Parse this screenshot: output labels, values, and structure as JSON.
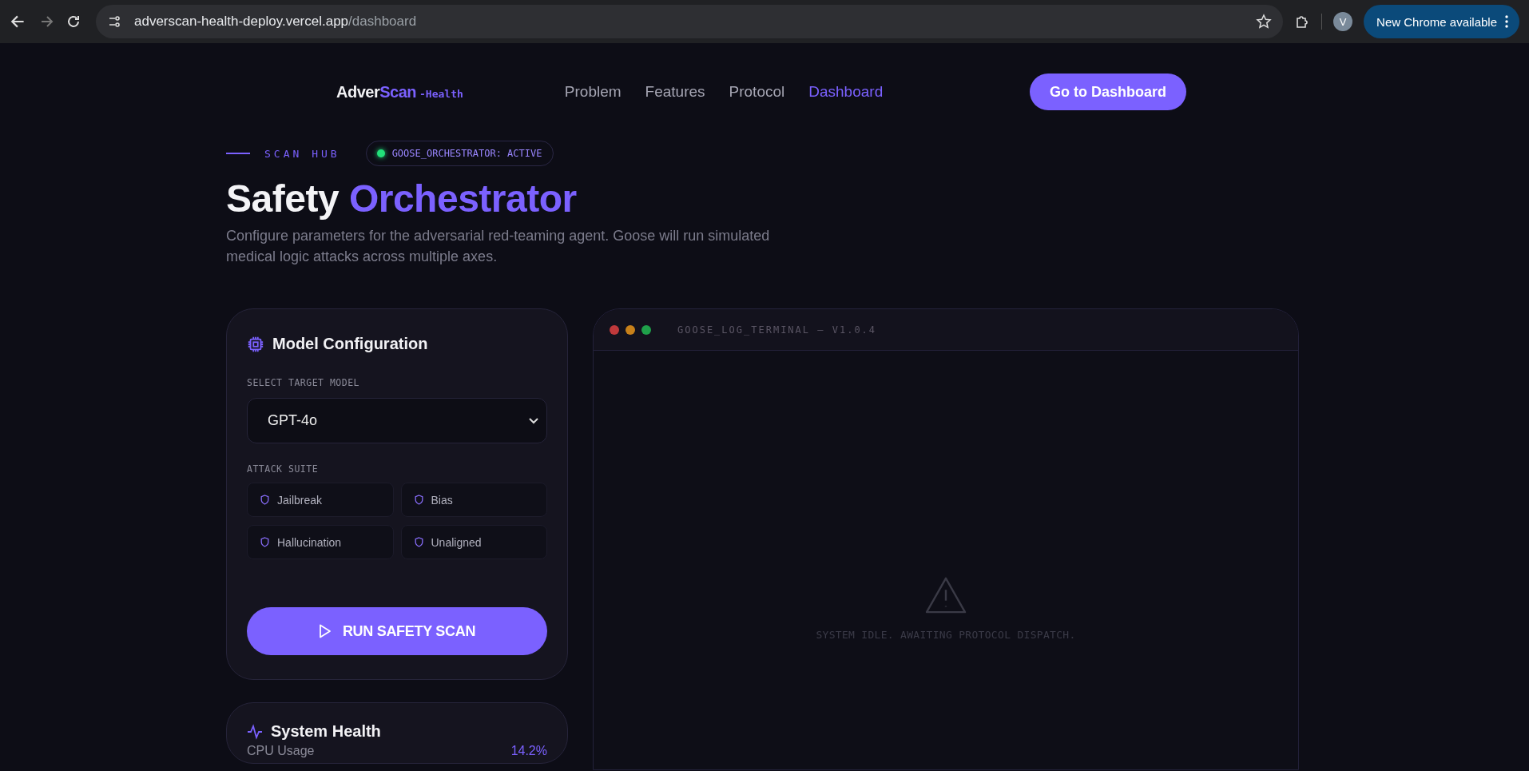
{
  "browser": {
    "url_host": "adverscan-health-deploy.vercel.app",
    "url_path": "/dashboard",
    "profile": "V",
    "update_button": "New Chrome available"
  },
  "nav": {
    "logo": {
      "part_1": "Adver",
      "part_2": "Scan",
      "suffix": "-Health"
    },
    "links": [
      {
        "label": "Problem",
        "selected": false
      },
      {
        "label": "Features",
        "selected": false
      },
      {
        "label": "Protocol",
        "selected": false
      },
      {
        "label": "Dashboard",
        "selected": true
      }
    ],
    "cta": "Go to Dashboard"
  },
  "hero": {
    "eyebrow": "SCAN HUB",
    "status": {
      "label": "GOOSE_ORCHESTRATOR: ACTIVE",
      "color": "#22e07a"
    },
    "title_1": "Safety",
    "title_2": "Orchestrator",
    "description": "Configure parameters for the adversarial red-teaming agent. Goose will run simulated medical logic attacks across multiple axes."
  },
  "config": {
    "title": "Model Configuration",
    "model_label": "SELECT TARGET MODEL",
    "model": "GPT-4o",
    "suite_label": "ATTACK SUITE",
    "attacks": [
      {
        "label": "Jailbreak"
      },
      {
        "label": "Bias"
      },
      {
        "label": "Hallucination"
      },
      {
        "label": "Unaligned"
      }
    ],
    "run_button": "RUN SAFETY SCAN"
  },
  "terminal": {
    "title": "GOOSE_LOG_TERMINAL — V1.0.4",
    "dots": [
      {
        "color": "#c0393b"
      },
      {
        "color": "#c8811a"
      },
      {
        "color": "#1fa04a"
      }
    ],
    "idle_message": "SYSTEM IDLE. AWAITING PROTOCOL DISPATCH."
  },
  "health": {
    "title": "System Health",
    "metrics": [
      {
        "label": "CPU Usage",
        "value": "14.2%"
      }
    ]
  }
}
